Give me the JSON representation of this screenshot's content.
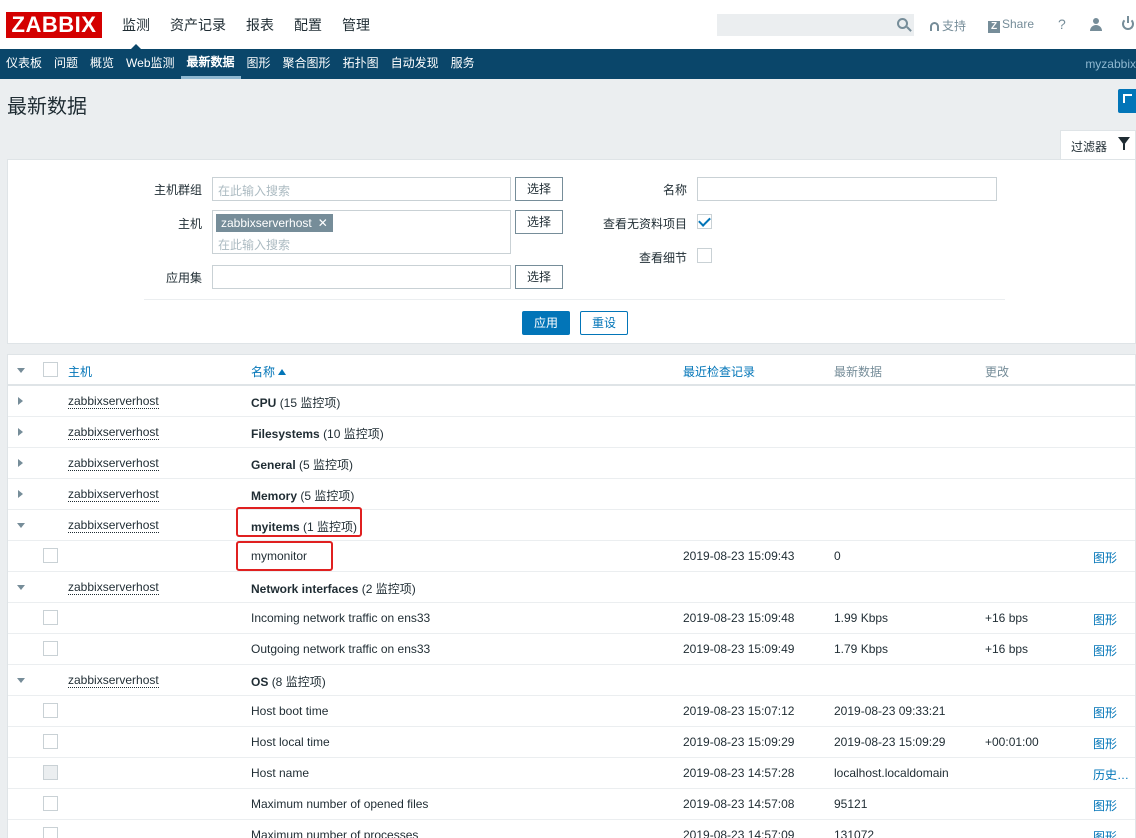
{
  "logo": "ZABBIX",
  "main_menu": [
    "监测",
    "资产记录",
    "报表",
    "配置",
    "管理"
  ],
  "main_menu_selected": 0,
  "top_links": {
    "support": "支持",
    "share": "Share",
    "help": "?"
  },
  "sub_menu": [
    "仪表板",
    "问题",
    "概览",
    "Web监测",
    "最新数据",
    "图形",
    "聚合图形",
    "拓扑图",
    "自动发现",
    "服务"
  ],
  "sub_menu_selected": 4,
  "user_host": "myzabbix",
  "page_title": "最新数据",
  "filter": {
    "tab_label": "过滤器",
    "host_group_label": "主机群组",
    "host_group_placeholder": "在此输入搜索",
    "host_label": "主机",
    "host_tag": "zabbixserverhost",
    "host_placeholder": "在此输入搜索",
    "app_label": "应用集",
    "select_label": "选择",
    "name_label": "名称",
    "show_without_data_label": "查看无资料项目",
    "show_without_data_checked": true,
    "show_details_label": "查看细节",
    "show_details_checked": false,
    "apply_label": "应用",
    "reset_label": "重设"
  },
  "table": {
    "columns": {
      "host": "主机",
      "name": "名称",
      "last_check": "最近检查记录",
      "last_value": "最新数据",
      "change": "更改"
    },
    "rows": [
      {
        "type": "group",
        "expanded": false,
        "host": "zabbixserverhost",
        "name": "CPU",
        "count": "(15 监控项)"
      },
      {
        "type": "group",
        "expanded": false,
        "host": "zabbixserverhost",
        "name": "Filesystems",
        "count": "(10 监控项)"
      },
      {
        "type": "group",
        "expanded": false,
        "host": "zabbixserverhost",
        "name": "General",
        "count": "(5 监控项)"
      },
      {
        "type": "group",
        "expanded": false,
        "host": "zabbixserverhost",
        "name": "Memory",
        "count": "(5 监控项)"
      },
      {
        "type": "group",
        "expanded": true,
        "host": "zabbixserverhost",
        "name": "myitems",
        "count": "(1 监控项)"
      },
      {
        "type": "item",
        "name": "mymonitor",
        "last_check": "2019-08-23 15:09:43",
        "last_value": "0",
        "change": "",
        "action": "图形"
      },
      {
        "type": "group",
        "expanded": true,
        "host": "zabbixserverhost",
        "name": "Network interfaces",
        "count": "(2 监控项)"
      },
      {
        "type": "item",
        "name": "Incoming network traffic on ens33",
        "last_check": "2019-08-23 15:09:48",
        "last_value": "1.99 Kbps",
        "change": "+16 bps",
        "action": "图形"
      },
      {
        "type": "item",
        "name": "Outgoing network traffic on ens33",
        "last_check": "2019-08-23 15:09:49",
        "last_value": "1.79 Kbps",
        "change": "+16 bps",
        "action": "图形"
      },
      {
        "type": "group",
        "expanded": true,
        "host": "zabbixserverhost",
        "name": "OS",
        "count": "(8 监控项)"
      },
      {
        "type": "item",
        "name": "Host boot time",
        "last_check": "2019-08-23 15:07:12",
        "last_value": "2019-08-23 09:33:21",
        "change": "",
        "action": "图形"
      },
      {
        "type": "item",
        "name": "Host local time",
        "last_check": "2019-08-23 15:09:29",
        "last_value": "2019-08-23 15:09:29",
        "change": "+00:01:00",
        "action": "图形"
      },
      {
        "type": "item",
        "name": "Host name",
        "last_check": "2019-08-23 14:57:28",
        "last_value": "localhost.localdomain",
        "change": "",
        "action": "历史…",
        "disabled": true
      },
      {
        "type": "item",
        "name": "Maximum number of opened files",
        "last_check": "2019-08-23 14:57:08",
        "last_value": "95121",
        "change": "",
        "action": "图形"
      },
      {
        "type": "item",
        "name": "Maximum number of processes",
        "last_check": "2019-08-23 14:57:09",
        "last_value": "131072",
        "change": "",
        "action": "图形"
      }
    ]
  },
  "colors": {
    "brand": "#d40000",
    "nav": "#0a466a",
    "accent": "#0275b8",
    "highlight": "#e02020"
  }
}
